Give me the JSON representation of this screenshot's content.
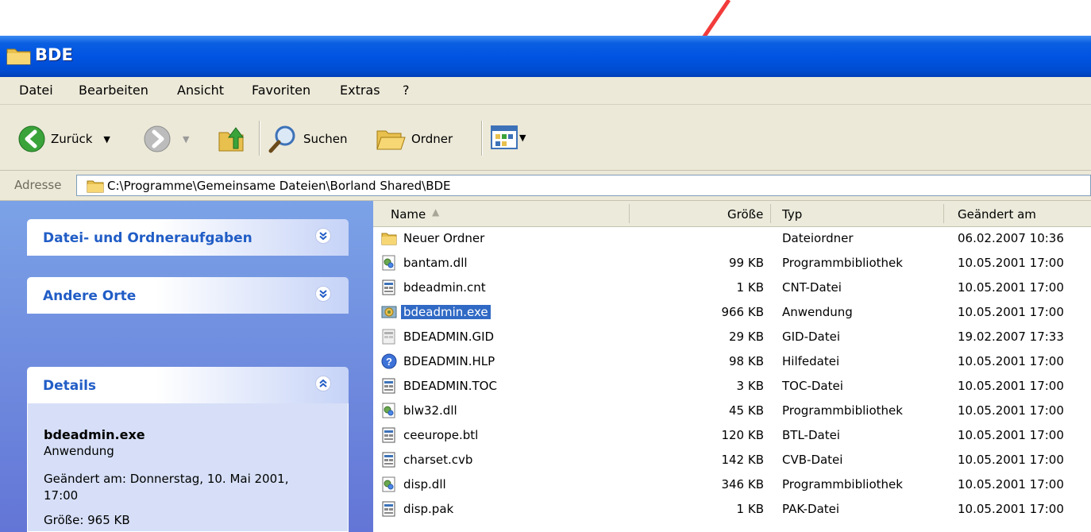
{
  "window": {
    "title": "BDE"
  },
  "menu": [
    "Datei",
    "Bearbeiten",
    "Ansicht",
    "Favoriten",
    "Extras",
    "?"
  ],
  "toolbar": {
    "back_label": "Zurück",
    "search_label": "Suchen",
    "folders_label": "Ordner"
  },
  "address": {
    "label": "Adresse",
    "path": "C:\\Programme\\Gemeinsame Dateien\\Borland Shared\\BDE"
  },
  "tasks": {
    "file_tasks": "Datei- und Ordneraufgaben",
    "other_places": "Andere Orte",
    "details": "Details",
    "details_name": "bdeadmin.exe",
    "details_type": "Anwendung",
    "details_modified": "Geändert am: Donnerstag, 10. Mai 2001, 17:00",
    "details_size": "Größe: 965 KB"
  },
  "columns": {
    "name": "Name",
    "size": "Größe",
    "type": "Typ",
    "modified": "Geändert am"
  },
  "files": [
    {
      "name": "Neuer Ordner",
      "size": "",
      "type": "Dateiordner",
      "modified": "06.02.2007 10:36",
      "icon": "folder"
    },
    {
      "name": "bantam.dll",
      "size": "99 KB",
      "type": "Programmbibliothek",
      "modified": "10.05.2001 17:00",
      "icon": "dll"
    },
    {
      "name": "bdeadmin.cnt",
      "size": "1 KB",
      "type": "CNT-Datei",
      "modified": "10.05.2001 17:00",
      "icon": "doc"
    },
    {
      "name": "bdeadmin.exe",
      "size": "966 KB",
      "type": "Anwendung",
      "modified": "10.05.2001 17:00",
      "icon": "exe"
    },
    {
      "name": "BDEADMIN.GID",
      "size": "29 KB",
      "type": "GID-Datei",
      "modified": "19.02.2007 17:33",
      "icon": "doc-gray"
    },
    {
      "name": "BDEADMIN.HLP",
      "size": "98 KB",
      "type": "Hilfedatei",
      "modified": "10.05.2001 17:00",
      "icon": "help"
    },
    {
      "name": "BDEADMIN.TOC",
      "size": "3 KB",
      "type": "TOC-Datei",
      "modified": "10.05.2001 17:00",
      "icon": "doc"
    },
    {
      "name": "blw32.dll",
      "size": "45 KB",
      "type": "Programmbibliothek",
      "modified": "10.05.2001 17:00",
      "icon": "dll"
    },
    {
      "name": "ceeurope.btl",
      "size": "120 KB",
      "type": "BTL-Datei",
      "modified": "10.05.2001 17:00",
      "icon": "doc"
    },
    {
      "name": "charset.cvb",
      "size": "142 KB",
      "type": "CVB-Datei",
      "modified": "10.05.2001 17:00",
      "icon": "doc"
    },
    {
      "name": "disp.dll",
      "size": "346 KB",
      "type": "Programmbibliothek",
      "modified": "10.05.2001 17:00",
      "icon": "dll"
    },
    {
      "name": "disp.pak",
      "size": "1 KB",
      "type": "PAK-Datei",
      "modified": "10.05.2001 17:00",
      "icon": "doc"
    }
  ],
  "selected_file": "bdeadmin.exe",
  "colors": {
    "title_blue": "#0054e3",
    "selection": "#316ac5",
    "arrow": "#f23b3b"
  }
}
